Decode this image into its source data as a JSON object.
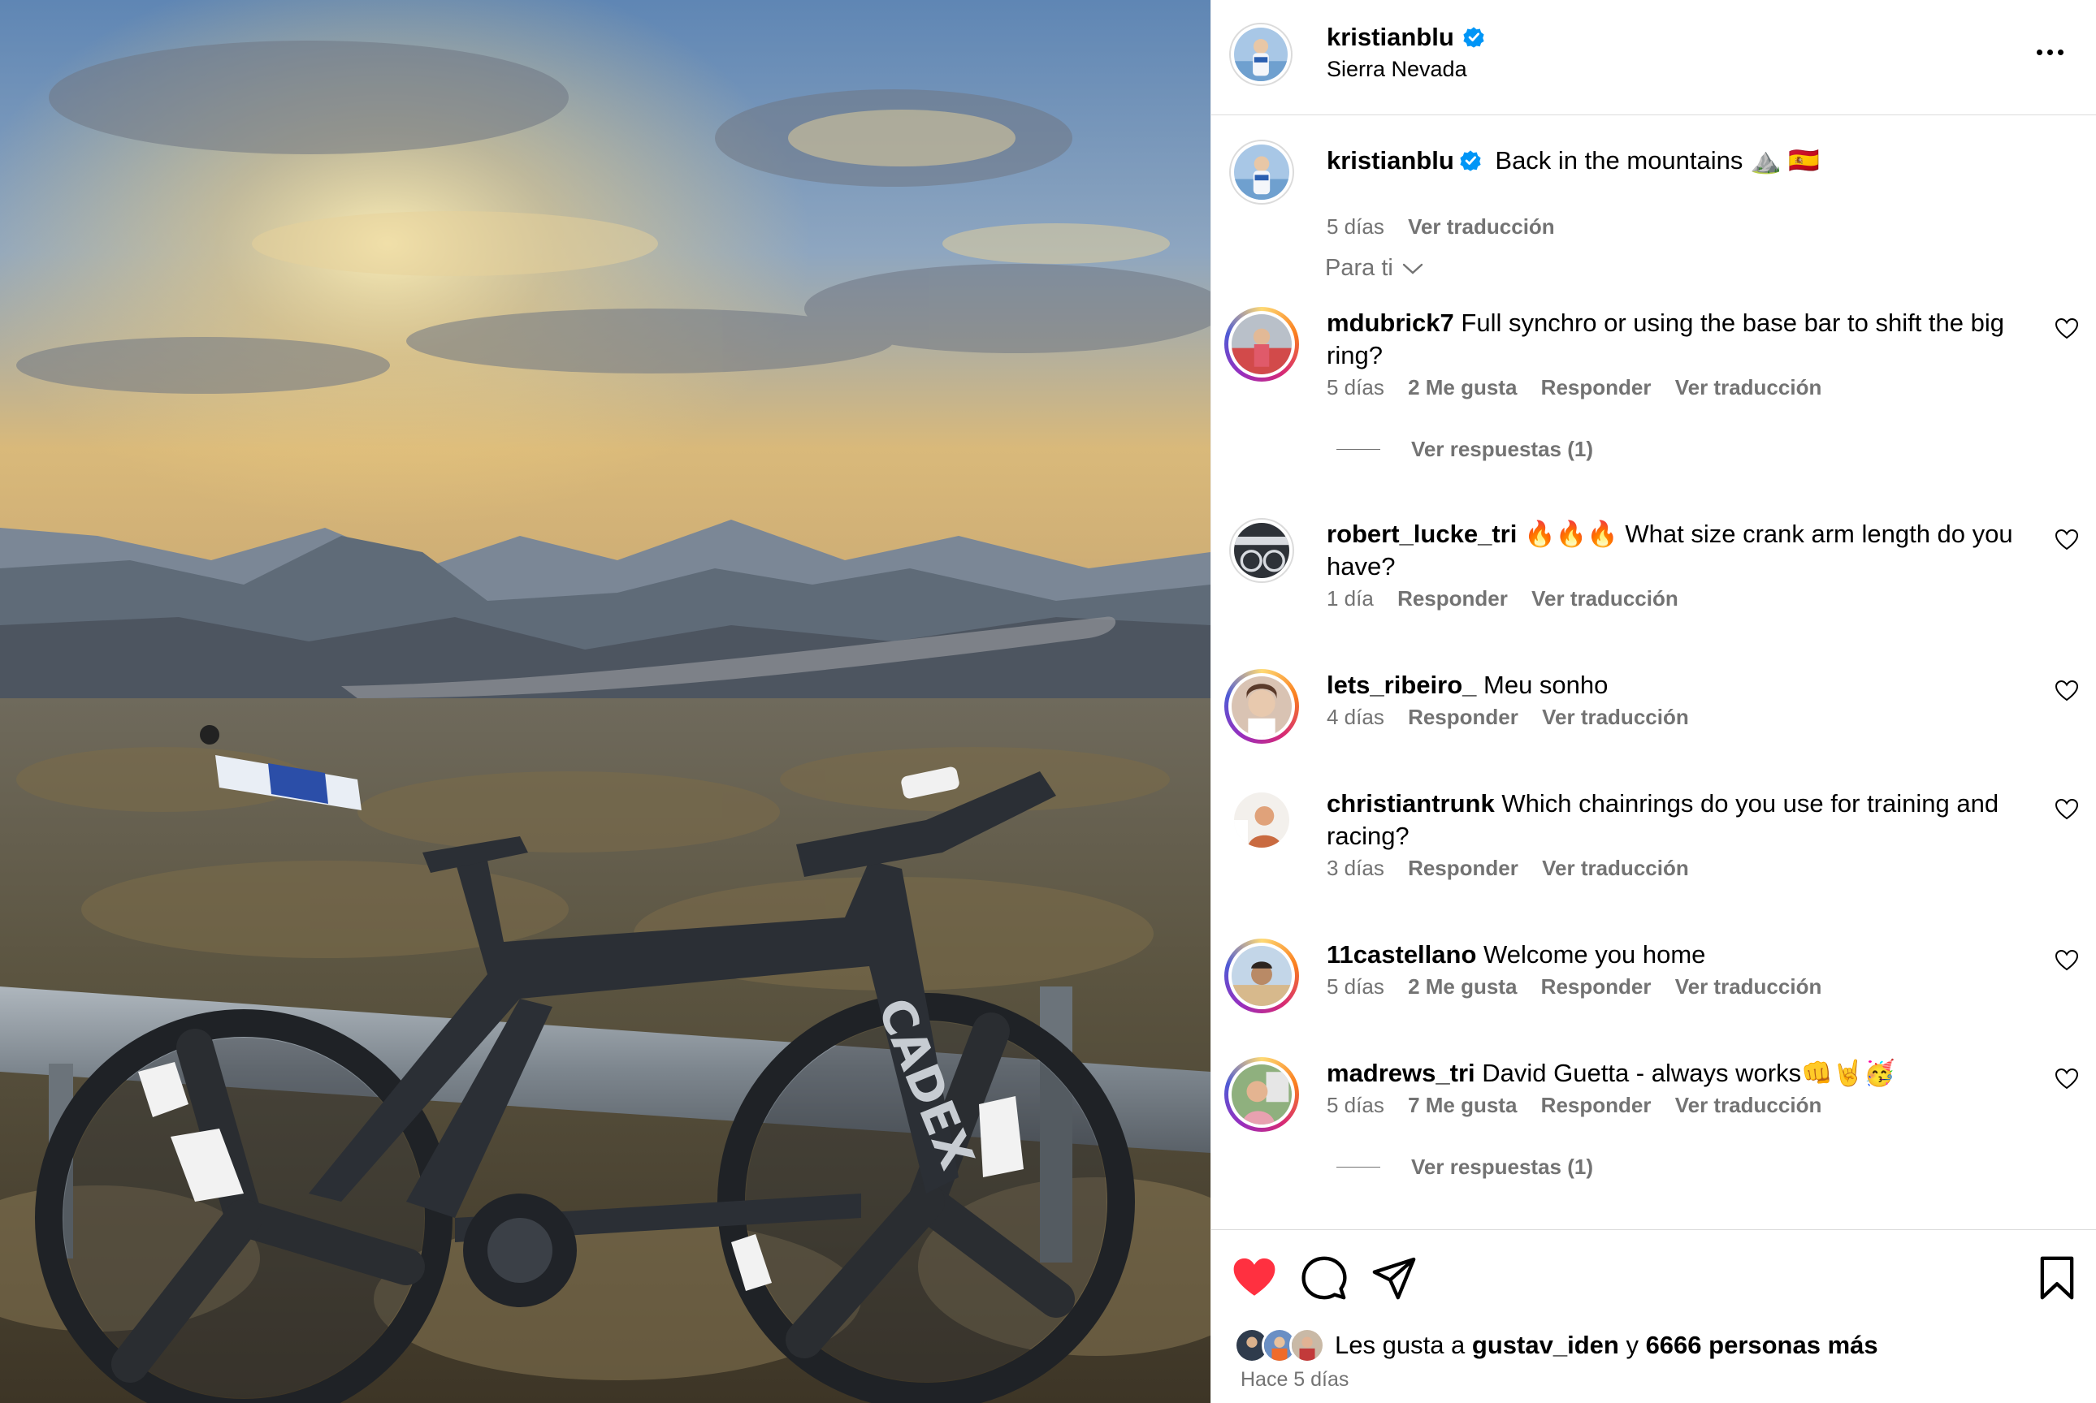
{
  "post": {
    "author": "kristianblu",
    "location": "Sierra Nevada",
    "caption_author": "kristianblu",
    "caption_text": "Back in the mountains ⛰️ 🇪🇸",
    "caption_time": "5 días",
    "caption_translate": "Ver traducción",
    "bike_brand": "CADEX"
  },
  "filter": {
    "label": "Para ti"
  },
  "comments": [
    {
      "user": "mdubrick7",
      "text": "Full synchro or using the base bar to shift the big ring?",
      "time": "5 días",
      "likes": "2 Me gusta",
      "reply": "Responder",
      "translate": "Ver traducción",
      "view_replies": "Ver respuestas (1)"
    },
    {
      "user": "robert_lucke_tri",
      "text": "🔥🔥🔥 What size crank arm length do you have?",
      "time": "1 día",
      "reply": "Responder",
      "translate": "Ver traducción"
    },
    {
      "user": "lets_ribeiro_",
      "text": "Meu sonho",
      "time": "4 días",
      "reply": "Responder",
      "translate": "Ver traducción"
    },
    {
      "user": "christiantrunk",
      "text": "Which chainrings do you use for training and racing?",
      "time": "3 días",
      "reply": "Responder",
      "translate": "Ver traducción"
    },
    {
      "user": "11castellano",
      "text": "Welcome you home",
      "time": "5 días",
      "likes": "2 Me gusta",
      "reply": "Responder",
      "translate": "Ver traducción"
    },
    {
      "user": "madrews_tri",
      "text": "David Guetta - always works👊🤘🥳",
      "time": "5 días",
      "likes": "7 Me gusta",
      "reply": "Responder",
      "translate": "Ver traducción",
      "view_replies": "Ver respuestas (1)"
    }
  ],
  "footer": {
    "likes_prefix": "Les gusta a",
    "likes_user": "gustav_iden",
    "likes_joiner": "y",
    "likes_others": "6666 personas más",
    "posted": "Hace 5 días"
  },
  "icons": {
    "like": "heart-filled-icon",
    "comment": "comment-icon",
    "share": "send-icon",
    "save": "bookmark-icon",
    "more": "more-options-icon",
    "verified": "verified-badge-icon"
  },
  "colors": {
    "like_red": "#ff3040",
    "verified_blue": "#0095f6",
    "muted_text": "#737373"
  }
}
